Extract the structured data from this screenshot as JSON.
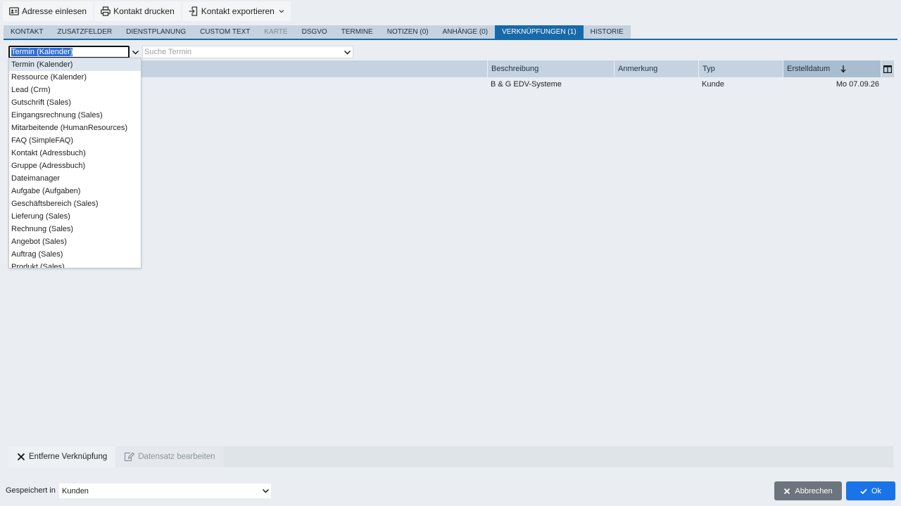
{
  "toolbar": {
    "import_label": "Adresse einlesen",
    "print_label": "Kontakt drucken",
    "export_label": "Kontakt exportieren"
  },
  "tabs": [
    {
      "label": "Kontakt",
      "state": "normal"
    },
    {
      "label": "Zusatzfelder",
      "state": "normal"
    },
    {
      "label": "Dienstplanung",
      "state": "normal"
    },
    {
      "label": "Custom Text",
      "state": "normal"
    },
    {
      "label": "Karte",
      "state": "disabled"
    },
    {
      "label": "DSGVO",
      "state": "normal"
    },
    {
      "label": "Termine",
      "state": "normal"
    },
    {
      "label": "Notizen (0)",
      "state": "normal"
    },
    {
      "label": "Anhänge (0)",
      "state": "normal"
    },
    {
      "label": "Verknüpfungen (1)",
      "state": "active"
    },
    {
      "label": "Historie",
      "state": "normal"
    }
  ],
  "filter": {
    "type_value": "Termin  (Kalender)",
    "search_placeholder": "Suche Termin"
  },
  "grid": {
    "columns": {
      "description": "Beschreibung",
      "note": "Anmerkung",
      "type": "Typ",
      "created": "Erstelldatum"
    },
    "sort_icon": "arrow-down-icon",
    "rows": [
      {
        "description": "B & G EDV-Systeme",
        "type": "Kunde",
        "created": "Mo 07.09.26"
      }
    ]
  },
  "dropdown": {
    "items": [
      "Termin (Kalender)",
      "Ressource (Kalender)",
      "Lead (Crm)",
      "Gutschrift (Sales)",
      "Eingangsrechnung (Sales)",
      "Mitarbeitende (HumanResources)",
      "FAQ (SimpleFAQ)",
      "Kontakt (Adressbuch)",
      "Gruppe (Adressbuch)",
      "Dateimanager",
      "Aufgabe (Aufgaben)",
      "Geschäftsbereich (Sales)",
      "Lieferung (Sales)",
      "Rechnung (Sales)",
      "Angebot (Sales)",
      "Auftrag (Sales)",
      "Produkt (Sales)"
    ],
    "selected_index": 0
  },
  "actions": {
    "remove_label": "Entferne Verknüpfung",
    "edit_label": "Datensatz bearbeiten"
  },
  "footer": {
    "saved_in_label": "Gespeichert in",
    "container_value": "Kunden",
    "cancel_label": "Abbrechen",
    "ok_label": "Ok"
  },
  "colors": {
    "tab_active": "#1769aa",
    "tab_inactive": "#c5d3e0",
    "ok_button": "#1a73e8",
    "cancel_button": "#6c757d"
  }
}
